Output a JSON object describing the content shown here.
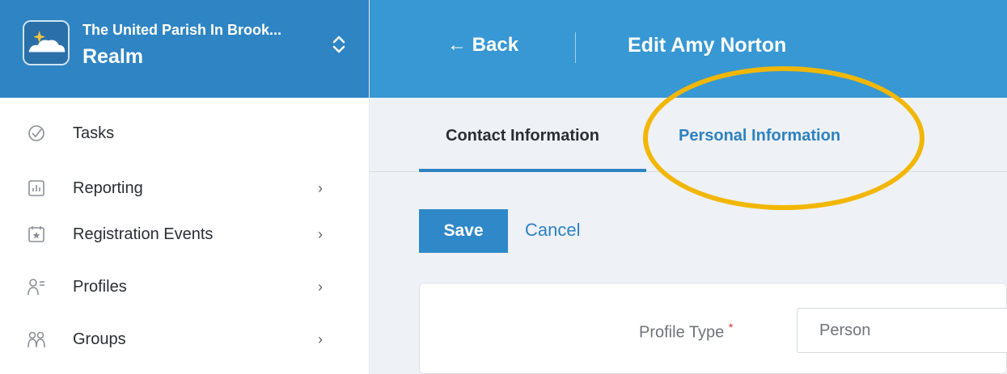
{
  "org": {
    "name": "The United Parish In Brook...",
    "product": "Realm"
  },
  "sidebar": {
    "items": [
      {
        "label": "Tasks",
        "icon": "check-circle-icon",
        "has_submenu": false
      },
      {
        "label": "Reporting",
        "icon": "bar-chart-icon",
        "has_submenu": true
      },
      {
        "label": "Registration Events",
        "icon": "calendar-star-icon",
        "has_submenu": true
      },
      {
        "label": "Profiles",
        "icon": "person-list-icon",
        "has_submenu": true
      },
      {
        "label": "Groups",
        "icon": "people-icon",
        "has_submenu": true
      }
    ],
    "chevron": "›"
  },
  "header": {
    "back_label": "← Back",
    "title": "Edit Amy Norton"
  },
  "tabs": [
    {
      "label": "Contact Information",
      "active": true
    },
    {
      "label": "Personal Information",
      "active": false
    }
  ],
  "actions": {
    "save_label": "Save",
    "cancel_label": "Cancel"
  },
  "form": {
    "profile_type_label": "Profile Type",
    "required_marker": "*",
    "profile_type_value": "Person"
  },
  "colors": {
    "sidebar_header": "#2f85c4",
    "topbar": "#3798d3",
    "accent": "#2d82c0",
    "highlight": "#f2b705"
  }
}
